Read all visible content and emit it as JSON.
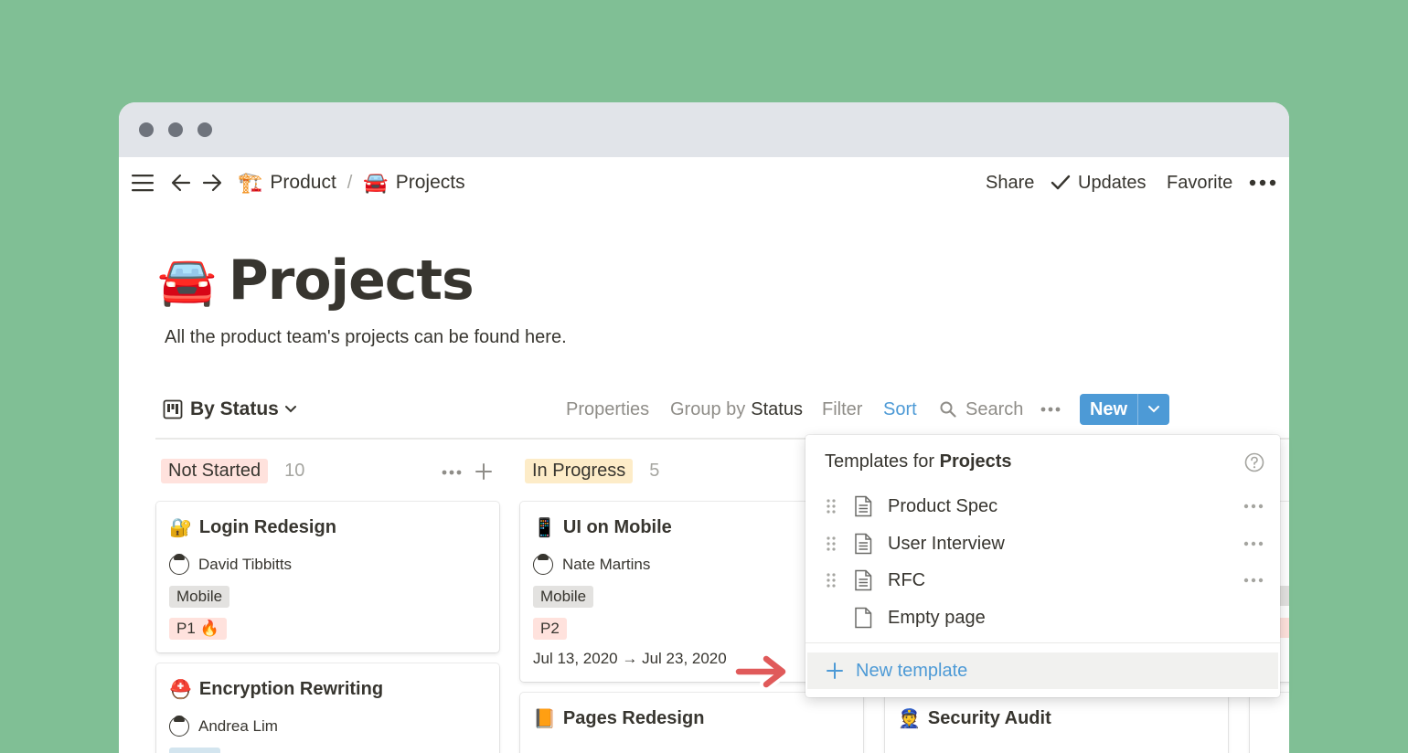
{
  "breadcrumb": [
    {
      "emoji": "🏗️",
      "label": "Product"
    },
    {
      "emoji": "🚘",
      "label": "Projects"
    }
  ],
  "breadcrumb_separator": "/",
  "topbar": {
    "share": "Share",
    "updates": "Updates",
    "favorite": "Favorite"
  },
  "page": {
    "emoji": "🚘",
    "title": "Projects",
    "description": "All the product team's projects can be found here."
  },
  "view": {
    "name": "By Status",
    "properties": "Properties",
    "group_by_prefix": "Group by",
    "group_by_value": "Status",
    "filter": "Filter",
    "sort": "Sort",
    "search": "Search",
    "new_label": "New"
  },
  "columns": [
    {
      "status": "Not Started",
      "count": "10",
      "color": "#ffe2dd"
    },
    {
      "status": "In Progress",
      "count": "5",
      "color": "#fdecc8"
    }
  ],
  "cards": {
    "login": {
      "emoji": "🔐",
      "title": "Login Redesign",
      "person": "David Tibbitts",
      "tag1": "Mobile",
      "tag2": "P1 🔥"
    },
    "encryption": {
      "emoji": "⛑️",
      "title": "Encryption Rewriting",
      "person": "Andrea Lim"
    },
    "ui_mobile": {
      "emoji": "📱",
      "title": "UI on Mobile",
      "person": "Nate Martins",
      "tag1": "Mobile",
      "tag2": "P2",
      "date": "Jul 13, 2020 → Jul 23, 2020"
    },
    "pages": {
      "emoji": "📙",
      "title": "Pages Redesign"
    },
    "security": {
      "emoji": "👮",
      "title": "Security Audit"
    }
  },
  "templates_menu": {
    "heading_prefix": "Templates for",
    "heading_bold": "Projects",
    "items": [
      {
        "label": "Product Spec"
      },
      {
        "label": "User Interview"
      },
      {
        "label": "RFC"
      },
      {
        "label": "Empty page"
      }
    ],
    "new_template": "New template"
  },
  "colors": {
    "background": "#80bf95",
    "accent_blue": "#4d9ad6",
    "tag_gray": "#e3e2e0",
    "tag_red": "#ffe2dd",
    "arrow_red": "#e05a5a"
  }
}
